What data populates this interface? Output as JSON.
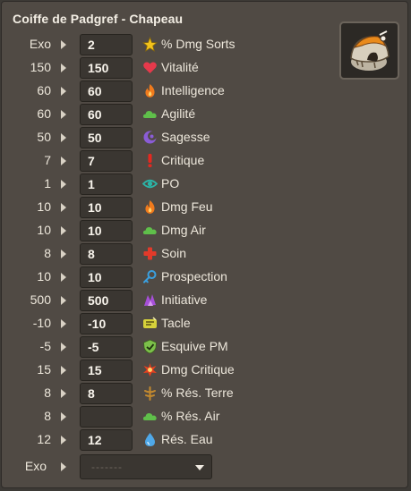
{
  "item": {
    "title": "Coiffe de Padgref - Chapeau",
    "icon": "padgref-hat-icon"
  },
  "stats": [
    {
      "base": "Exo",
      "value": "2",
      "name": "% Dmg Sorts",
      "icon": "star-icon",
      "color": "#f2c21b"
    },
    {
      "base": "150",
      "value": "150",
      "name": "Vitalité",
      "icon": "heart-icon",
      "color": "#e6394b"
    },
    {
      "base": "60",
      "value": "60",
      "name": "Intelligence",
      "icon": "fire-icon",
      "color": "#f07a1c"
    },
    {
      "base": "60",
      "value": "60",
      "name": "Agilité",
      "icon": "air-cloud-icon",
      "color": "#5fbf4a"
    },
    {
      "base": "50",
      "value": "50",
      "name": "Sagesse",
      "icon": "moon-swirl-icon",
      "color": "#8a5cd6"
    },
    {
      "base": "7",
      "value": "7",
      "name": "Critique",
      "icon": "exclamation-icon",
      "color": "#e5281f"
    },
    {
      "base": "1",
      "value": "1",
      "name": "PO",
      "icon": "eye-icon",
      "color": "#2bb5a8"
    },
    {
      "base": "10",
      "value": "10",
      "name": "Dmg Feu",
      "icon": "fire-icon",
      "color": "#f07a1c"
    },
    {
      "base": "10",
      "value": "10",
      "name": "Dmg Air",
      "icon": "air-cloud-icon",
      "color": "#5fbf4a"
    },
    {
      "base": "8",
      "value": "8",
      "name": "Soin",
      "icon": "red-cross-icon",
      "color": "#e23a2a"
    },
    {
      "base": "10",
      "value": "10",
      "name": "Prospection",
      "icon": "key-icon",
      "color": "#3aa0e0"
    },
    {
      "base": "500",
      "value": "500",
      "name": "Initiative",
      "icon": "initiative-icon",
      "color": "#a64fd8"
    },
    {
      "base": "-10",
      "value": "-10",
      "name": "Tacle",
      "icon": "tackle-icon",
      "color": "#d6d23a"
    },
    {
      "base": "-5",
      "value": "-5",
      "name": "Esquive PM",
      "icon": "dodge-mp-icon",
      "color": "#7cc04a"
    },
    {
      "base": "15",
      "value": "15",
      "name": "Dmg Critique",
      "icon": "critical-damage-icon",
      "color": "#e8401f"
    },
    {
      "base": "8",
      "value": "8",
      "name": "% Rés. Terre",
      "icon": "earth-res-icon",
      "color": "#c48a2e"
    },
    {
      "base": "8",
      "value": "",
      "name": "% Rés. Air",
      "icon": "air-cloud-icon",
      "color": "#5fbf4a"
    },
    {
      "base": "12",
      "value": "12",
      "name": "Rés. Eau",
      "icon": "water-drop-icon",
      "color": "#4fa8e8"
    }
  ],
  "exo": {
    "label": "Exo",
    "placeholder": "-------"
  }
}
